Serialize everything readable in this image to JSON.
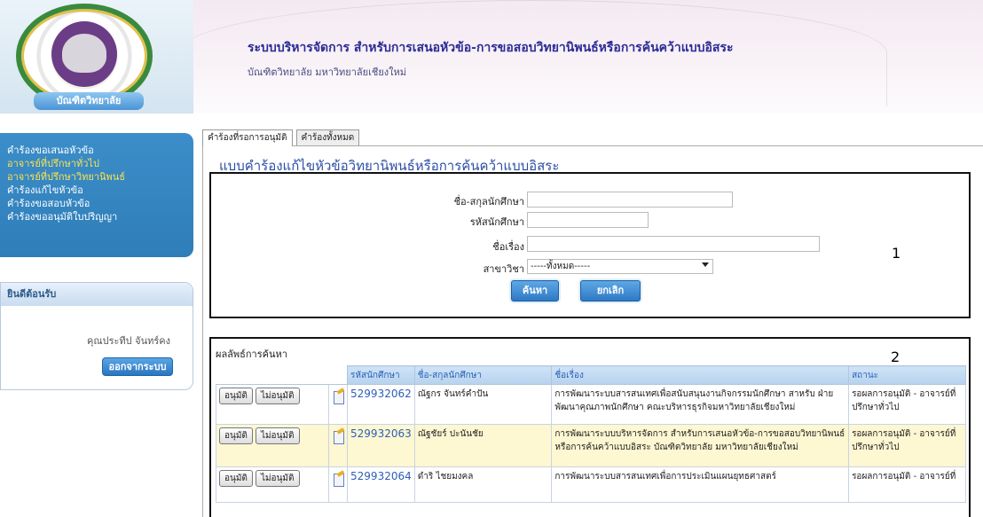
{
  "header": {
    "title": "ระบบบริหารจัดการ สำหรับการเสนอหัวข้อ-การขอสอบวิทยานิพนธ์หรือการค้นคว้าแบบอิสระ",
    "subtitle": "บัณฑิตวิทยาลัย มหาวิทยาลัยเชียงใหม่",
    "logo_banner": "บัณฑิตวิทยาลัย"
  },
  "sidebar": {
    "items": [
      {
        "label": "คำร้องขอเสนอหัวข้อ",
        "active": false
      },
      {
        "label": "อาจารย์ที่ปรึกษาทั่วไป",
        "active": true
      },
      {
        "label": "อาจารย์ที่ปรึกษาวิทยานิพนธ์",
        "active": true
      },
      {
        "label": "คำร้องแก้ไขหัวข้อ",
        "active": false
      },
      {
        "label": "คำร้องขอสอบหัวข้อ",
        "active": false
      },
      {
        "label": "คำร้องขออนุมัติใบปริญญา",
        "active": false
      }
    ],
    "welcome_title": "ยินดีต้อนรับ",
    "user_name": "คุณประทีป จันทร์คง",
    "logout_label": "ออกจากระบบ"
  },
  "tabs": [
    {
      "label": "คำร้องที่รอการอนุมัติ",
      "active": true
    },
    {
      "label": "คำร้องทั้งหมด",
      "active": false
    }
  ],
  "form": {
    "title": "แบบคำร้องแก้ไขหัวข้อวิทยานิพนธ์หรือการค้นคว้าแบบอิสระ",
    "name_label": "ชื่อ-สกุลนักศึกษา",
    "name_value": "",
    "id_label": "รหัสนักศึกษา",
    "id_value": "",
    "subject_label": "ชื่อเรื่อง",
    "subject_value": "",
    "major_label": "สาขาวิชา",
    "major_value": "-----ทั้งหมด-----",
    "search_label": "ค้นหา",
    "cancel_label": "ยกเลิก",
    "box_number": "1"
  },
  "results": {
    "title": "ผลลัพธ์การค้นหา",
    "box_number": "2",
    "columns": [
      "รหัสนักศึกษา",
      "ชื่อ-สกุลนักศึกษา",
      "ชื่อเรื่อง",
      "สถานะ"
    ],
    "approve_label": "อนุมัติ",
    "reject_label": "ไม่อนุมัติ",
    "rows": [
      {
        "student_id": "529932062",
        "name": "ณัฐกร จันทร์คำปัน",
        "subject": "การพัฒนาระบบสารสนเทศเพื่อสนับสนุนงานกิจกรรมนักศึกษา สาหรับ ฝ่ายพัฒนาคุณภาพนักศึกษา คณะบริหารธุรกิจมหาวิทยาลัยเชียงใหม่",
        "status": "รอผลการอนุมัติ - อาจารย์ที่ปรึกษาทั่วไป"
      },
      {
        "student_id": "529932063",
        "name": "ณัฐชัยร์ ปะนันชัย",
        "subject": "การพัฒนาระบบบริหารจัดการ สำหรับการเสนอหัวข้อ-การขอสอบวิทยานิพนธ์หรือการค้นคว้าแบบอิสระ บัณฑิตวิทยาลัย มหาวิทยาลัยเชียงใหม่",
        "status": "รอผลการอนุมัติ - อาจารย์ที่ปรึกษาทั่วไป"
      },
      {
        "student_id": "529932064",
        "name": "ดำริ ไชยมงคล",
        "subject": "การพัฒนาระบบสารสนเทศเพื่อการประเมินแผนยุทธศาสตร์",
        "status": "รอผลการอนุมัติ - อาจารย์ที่"
      }
    ]
  }
}
